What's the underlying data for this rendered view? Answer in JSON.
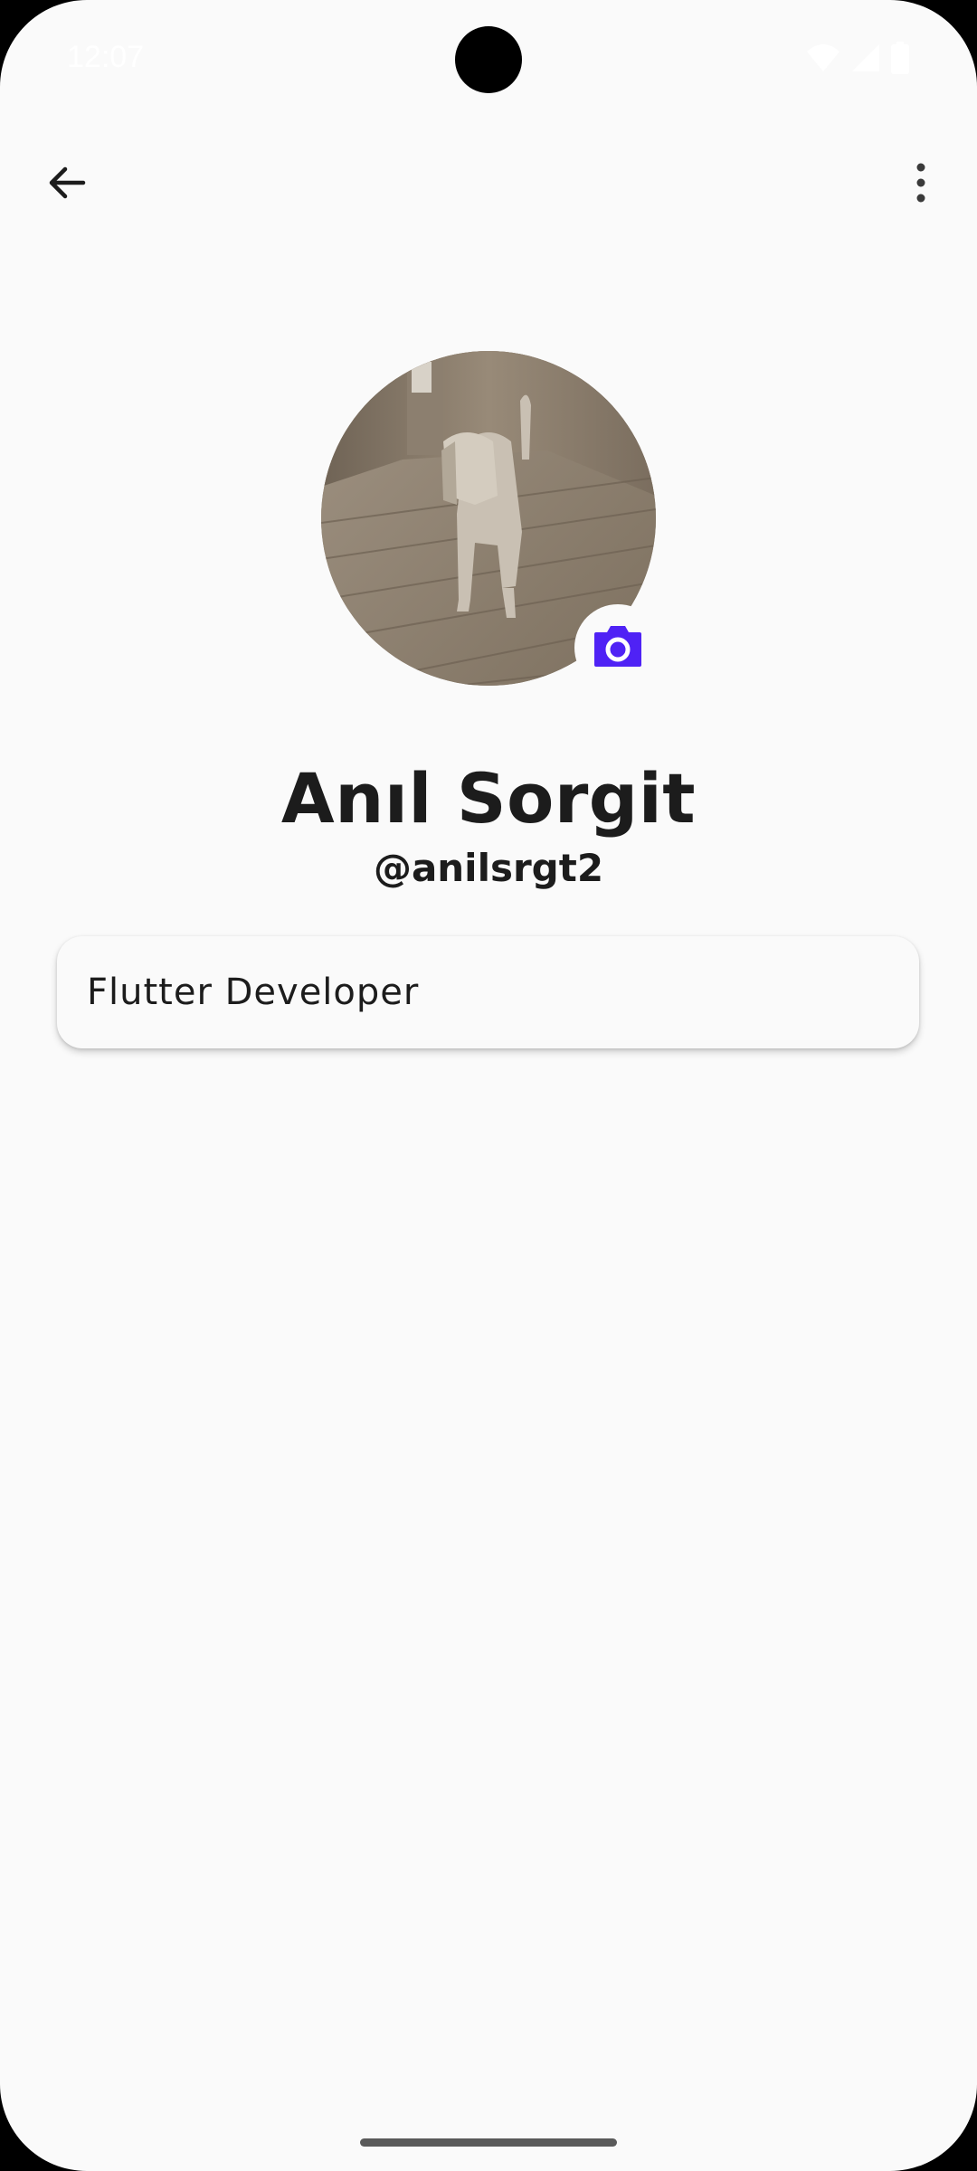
{
  "status_bar": {
    "time": "12:07",
    "icons": [
      "wifi-icon",
      "cellular-signal-icon",
      "battery-icon"
    ]
  },
  "app_bar": {
    "back_icon": "arrow-back-icon",
    "menu_icon": "more-vert-icon"
  },
  "profile": {
    "avatar": "dog-photo",
    "camera_icon": "camera-icon",
    "name": "Anıl Sorgit",
    "handle": "@anilsrgt2",
    "bio": "Flutter Developer"
  },
  "colors": {
    "accent": "#4f22f5",
    "background": "#fafafa",
    "text": "#1c1c1c"
  }
}
